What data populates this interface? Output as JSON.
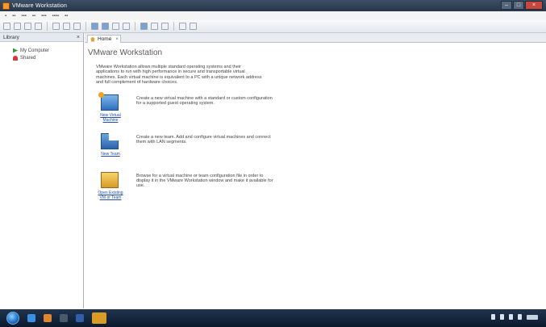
{
  "window": {
    "title": "VMware Workstation"
  },
  "sidebar": {
    "title": "Library",
    "close": "×",
    "items": [
      {
        "label": "My Computer",
        "icon": "vm-icon"
      },
      {
        "label": "Shared",
        "icon": "heart-icon"
      }
    ]
  },
  "tabs": [
    {
      "label": "Home",
      "close": "×"
    }
  ],
  "home": {
    "title": "VMware Workstation",
    "intro": "VMware Workstation allows multiple standard operating systems and their applications to run with high performance in secure and transportable virtual machines. Each virtual machine is equivalent to a PC with a unique network address and full complement of hardware choices.",
    "actions": [
      {
        "label": "New Virtual Machine",
        "description": "Create a new virtual machine with a standard or custom configuration for a supported guest operating system."
      },
      {
        "label": "New Team",
        "description": "Create a new team. Add and configure virtual machines and connect them with LAN segments."
      },
      {
        "label": "Open Existing VM or Team",
        "description": "Browse for a virtual machine or team configuration file in order to display it in the VMware Workstation window and make it available for use."
      }
    ]
  },
  "colors": {
    "titlebar": "#273749",
    "accent": "#1f4fa8",
    "taskbar": "#0d1a2c"
  }
}
